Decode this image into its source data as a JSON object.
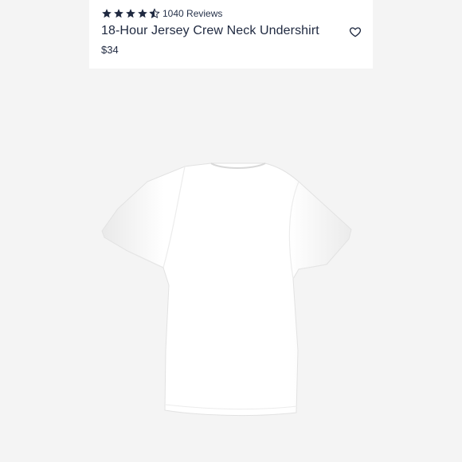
{
  "product": {
    "rating": 4.5,
    "rating_max": 5,
    "reviews_label": "1040 Reviews",
    "title": "18-Hour Jersey Crew Neck Undershirt",
    "price": "$34"
  },
  "icons": {
    "star": "star-icon",
    "wishlist": "heart-outline-icon"
  },
  "colors": {
    "star": "#1f2940",
    "text": "#1f2940",
    "background": "#f4f4f4",
    "shirt": "#ffffff"
  }
}
